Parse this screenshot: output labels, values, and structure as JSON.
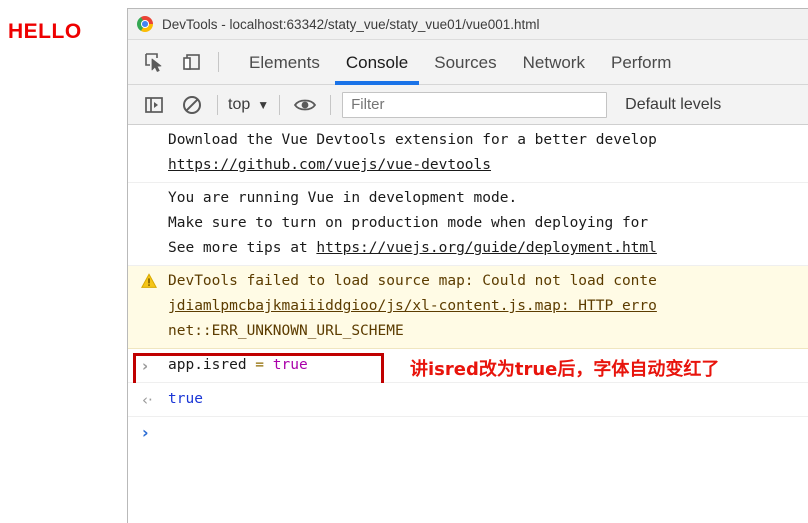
{
  "page": {
    "hello_text": "HELLO"
  },
  "window": {
    "title": "DevTools - localhost:63342/staty_vue/staty_vue01/vue001.html",
    "logo_icon": "chrome-logo-icon"
  },
  "tabbar": {
    "inspect_icon": "inspect-element-icon",
    "device_icon": "device-toolbar-icon",
    "tabs": [
      {
        "label": "Elements",
        "active": false
      },
      {
        "label": "Console",
        "active": true
      },
      {
        "label": "Sources",
        "active": false
      },
      {
        "label": "Network",
        "active": false
      },
      {
        "label": "Perform",
        "active": false
      }
    ]
  },
  "console_toolbar": {
    "clear_console_icon": "clear-console-icon",
    "no_entry_icon": "no-entry-icon",
    "context_label": "top",
    "context_caret": "▼",
    "eye_icon": "eye-icon",
    "filter_placeholder": "Filter",
    "filter_value": "",
    "levels_label": "Default levels"
  },
  "console": {
    "messages": [
      {
        "type": "log",
        "lines": [
          {
            "text": "Download the Vue Devtools extension for a better develop",
            "link": false
          },
          {
            "text": "https://github.com/vuejs/vue-devtools",
            "link": true
          }
        ]
      },
      {
        "type": "log",
        "lines": [
          {
            "text": "You are running Vue in development mode.",
            "link": false
          },
          {
            "text": "Make sure to turn on production mode when deploying for",
            "link": false
          },
          {
            "text": "See more tips at ",
            "link": false,
            "trailing_link": "https://vuejs.org/guide/deployment.html"
          }
        ]
      },
      {
        "type": "warning",
        "icon": "warning-triangle-icon",
        "lines": [
          {
            "text": "DevTools failed to load source map: Could not load conte",
            "link": false
          },
          {
            "text": "jdiamlpmcbajkmaiiiddgioo/js/xl-content.js.map: HTTP erro",
            "link": true,
            "suffix": ""
          },
          {
            "text": "net::ERR_UNKNOWN_URL_SCHEME",
            "link": false
          }
        ]
      }
    ],
    "input_line": {
      "prompt": "›",
      "code_parts": [
        {
          "text": "app.isred",
          "kind": "ident"
        },
        {
          "text": " = ",
          "kind": "op"
        },
        {
          "text": "true",
          "kind": "bool"
        }
      ]
    },
    "annotation": {
      "text": "讲isred改为true后，字体自动变红了",
      "color": "#e8140c",
      "box_color": "#c00000"
    },
    "output_line": {
      "marker": "‹·",
      "value": "true"
    },
    "new_prompt": {
      "marker": "›"
    }
  },
  "colors": {
    "accent_blue": "#1a73e8",
    "warning_bg": "#fffbe5",
    "warning_text": "#5c3c00",
    "output_blue": "#1a36d6",
    "bool_purple": "#aa00aa",
    "hello_red": "#ee0000"
  }
}
